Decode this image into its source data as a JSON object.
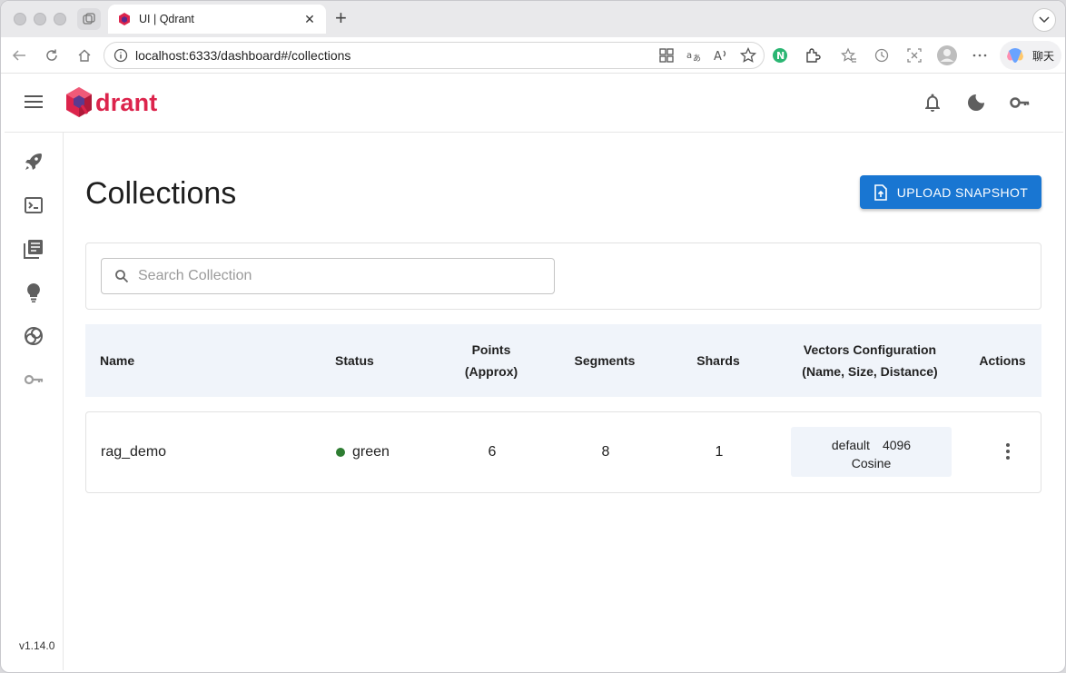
{
  "browser": {
    "tab_title": "UI | Qdrant",
    "url": "localhost:6333/dashboard#/collections",
    "copilot_label": "聊天"
  },
  "app": {
    "logo_text": "drant",
    "version": "v1.14.0",
    "accent_color": "#1976d2",
    "brand_color": "#dc244c"
  },
  "page": {
    "title": "Collections",
    "upload_label": "UPLOAD SNAPSHOT",
    "search_placeholder": "Search Collection"
  },
  "table": {
    "headers": {
      "name": "Name",
      "status": "Status",
      "points_line1": "Points",
      "points_line2": "(Approx)",
      "segments": "Segments",
      "shards": "Shards",
      "vectors_line1": "Vectors Configuration",
      "vectors_line2": "(Name, Size, Distance)",
      "actions": "Actions"
    },
    "rows": [
      {
        "name": "rag_demo",
        "status": "green",
        "status_color": "#2e7d32",
        "points": "6",
        "segments": "8",
        "shards": "1",
        "vector_name": "default",
        "vector_size": "4096",
        "vector_distance": "Cosine"
      }
    ]
  }
}
